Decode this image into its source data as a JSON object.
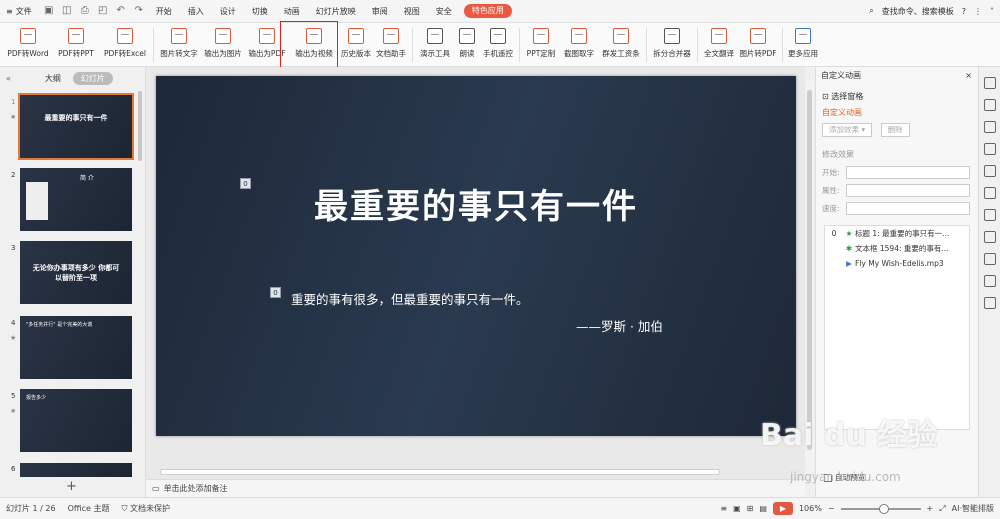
{
  "menu": {
    "file": "文件",
    "tabs": [
      "开始",
      "插入",
      "设计",
      "切换",
      "动画",
      "幻灯片放映",
      "审阅",
      "视图",
      "安全"
    ],
    "active_tab": "特色应用",
    "search": "查找命令、搜索模板"
  },
  "ribbon": {
    "buttons": [
      "PDF转Word",
      "PDF转PPT",
      "PDF转Excel",
      "图片转文字",
      "输出为图片",
      "输出为PDF",
      "输出为视频",
      "历史版本",
      "文档助手",
      "演示工具",
      "朗读",
      "手机遥控",
      "PPT定制",
      "截图取字",
      "群发工资条",
      "拆分合并器",
      "全文翻译",
      "图片转PDF",
      "更多应用"
    ]
  },
  "left_panel": {
    "tab_outline": "大纲",
    "tab_slides": "幻灯片",
    "thumbs": [
      {
        "num": "1",
        "title": "最重要的事只有一件"
      },
      {
        "num": "2",
        "title": "简 介"
      },
      {
        "num": "3",
        "title": "无论你办事项有多少 你都可以替阶至一项"
      },
      {
        "num": "4",
        "title": "\"多任务并行\" 是个完美的大谎"
      },
      {
        "num": "5",
        "title": "报告多少"
      },
      {
        "num": "6",
        "title": ""
      }
    ],
    "add": "+"
  },
  "slide": {
    "title": "最重要的事只有一件",
    "subtitle": "重要的事有很多，但最重要的事只有一件。",
    "author": "——罗斯 · 加伯",
    "tag1": "0",
    "tag2": "0"
  },
  "notes": {
    "placeholder": "单击此处添加备注"
  },
  "right_panel": {
    "header": "自定义动画",
    "select_pane": "选择窗格",
    "section": "自定义动画",
    "add_effect": "添加效果",
    "delete": "删除",
    "modify": "修改效果",
    "start_label": "开始:",
    "property_label": "属性:",
    "speed_label": "速度:",
    "anim_items": [
      {
        "num": "0",
        "text": "标题 1: 最重要的事只有一..."
      },
      {
        "num": "",
        "text": "文本框 1594: 重要的事有..."
      },
      {
        "num": "",
        "text": "Fly My Wish-Edelis.mp3"
      }
    ],
    "auto_preview": "自动预览"
  },
  "status": {
    "slide_info": "幻灯片 1 / 26",
    "theme": "Office 主题",
    "protect": "文档未保护",
    "zoom": "106%",
    "ai": "AI·智能排版"
  },
  "watermark": {
    "main": "Bai du 经验",
    "sub": "jingyan.baidu.com"
  }
}
